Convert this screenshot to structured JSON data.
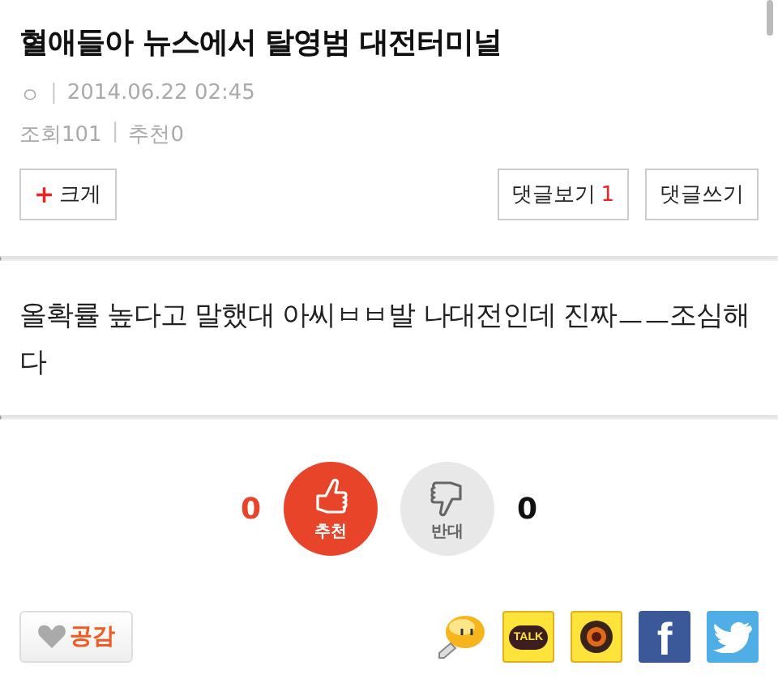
{
  "article": {
    "title": "혈애들아 뉴스에서 탈영범 대전터미널",
    "author": "ㅇ",
    "separator": "|",
    "date": "2014.06.22 02:45",
    "views": "조회101",
    "stats_separator": "|",
    "recommends": "추천0"
  },
  "toolbar": {
    "enlarge": {
      "icon": "+",
      "label": "크게"
    },
    "buttons": [
      {
        "label": "댓글보기",
        "count": "1"
      },
      {
        "label": "댓글쓰기"
      }
    ]
  },
  "body": "올확률 높다고 말했대 아씨ㅂㅂ발 나대전인데 진짜ㅡㅡ조심해 다",
  "votes": [
    {
      "kind": "up",
      "count": "0",
      "label": "추천"
    },
    {
      "kind": "down",
      "count": "0",
      "label": "반대"
    }
  ],
  "empathy": {
    "label": "공감"
  },
  "share": [
    {
      "kind": "emoticon"
    },
    {
      "kind": "talk",
      "text": "TALK"
    },
    {
      "kind": "story"
    },
    {
      "kind": "facebook",
      "text": "f"
    },
    {
      "kind": "twitter"
    }
  ]
}
